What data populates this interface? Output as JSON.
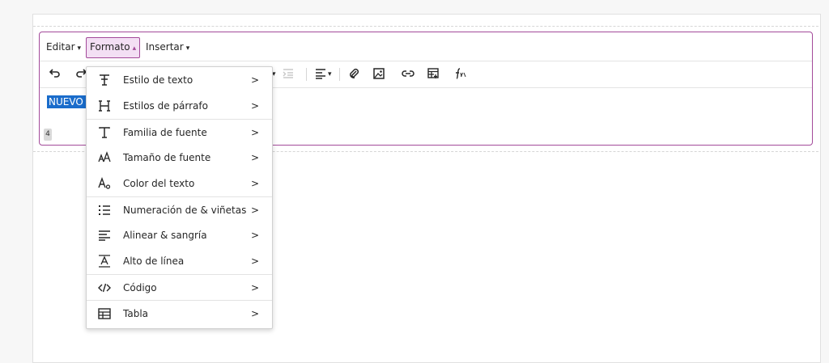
{
  "menubar": {
    "items": [
      {
        "label": "Editar",
        "caret": "▾",
        "active": false
      },
      {
        "label": "Formato",
        "caret": "▴",
        "active": true
      },
      {
        "label": "Insertar",
        "caret": "▾",
        "active": false
      }
    ]
  },
  "toolbar": {
    "undo_icon": "undo-icon",
    "redo_icon": "redo-icon",
    "list_caret": "▾",
    "align_caret": "▾",
    "icons": [
      "undo-icon",
      "redo-icon",
      "list-dropdown-icon",
      "indent-icon",
      "align-icon",
      "attach-icon",
      "image-icon",
      "link-icon",
      "table-insert-icon",
      "formula-icon"
    ]
  },
  "editor": {
    "selected_text": "NUEVO E",
    "word_count": "4"
  },
  "format_menu": {
    "items": [
      {
        "label": "Estilo de texto",
        "icon": "text-style-icon",
        "glyph": "Ŧ"
      },
      {
        "label": "Estilos de párrafo",
        "icon": "heading-icon",
        "glyph": "H"
      },
      {
        "label": "Familia de fuente",
        "icon": "font-family-icon",
        "glyph": "T"
      },
      {
        "label": "Tamaño de fuente",
        "icon": "font-size-icon",
        "glyph": "ᴬA"
      },
      {
        "label": "Color del texto",
        "icon": "text-color-icon",
        "glyph": "A₀"
      },
      {
        "label": "Numeración de & viñetas",
        "icon": "list-icon",
        "glyph": "⋮☰"
      },
      {
        "label": "Alinear & sangría",
        "icon": "align-left-icon",
        "glyph": "☰"
      },
      {
        "label": "Alto de línea",
        "icon": "line-height-icon",
        "glyph": "A̲"
      },
      {
        "label": "Código",
        "icon": "code-icon",
        "glyph": "</>"
      },
      {
        "label": "Tabla",
        "icon": "table-icon",
        "glyph": "⊞"
      }
    ],
    "chevron": ">"
  },
  "colors": {
    "accent": "#a34a9a",
    "accent_bg": "#f3dff4",
    "selection": "#1a6ccb"
  }
}
